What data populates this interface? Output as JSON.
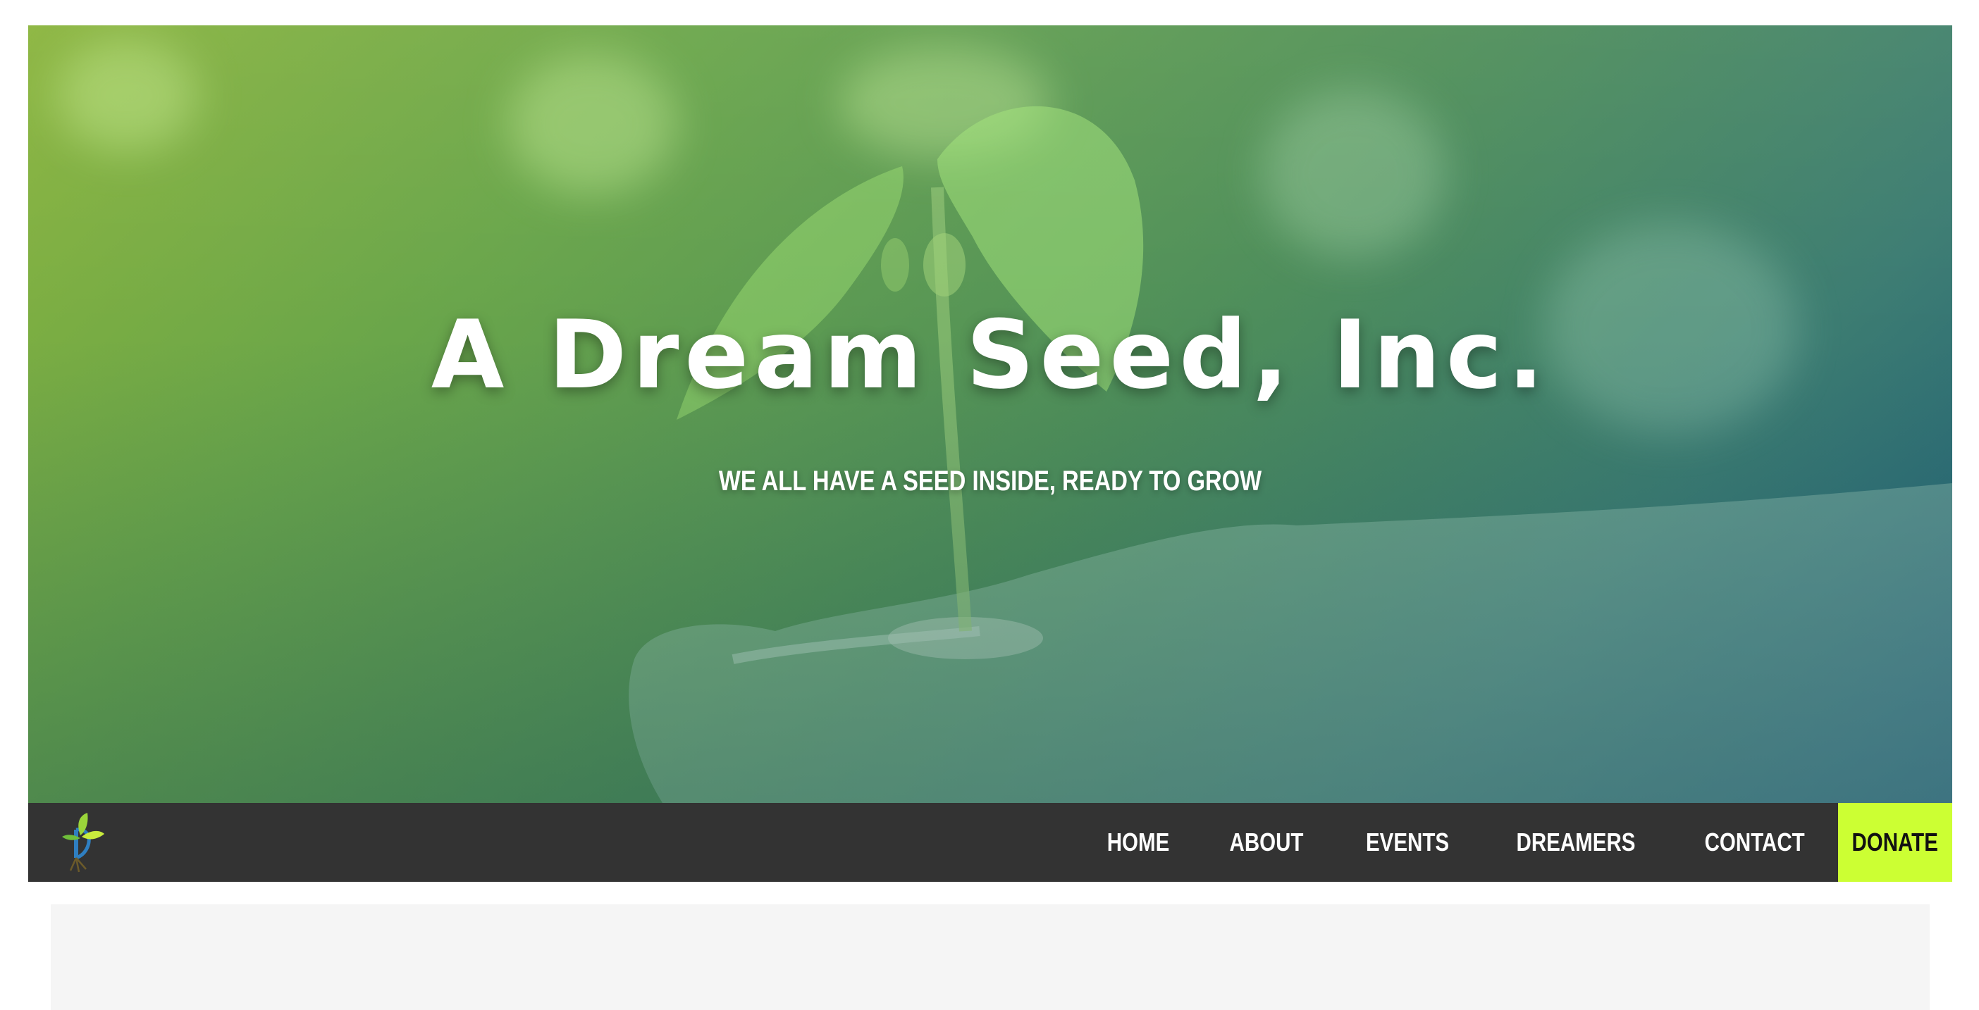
{
  "hero": {
    "title": "A Dream Seed, Inc.",
    "subtitle": "WE ALL HAVE A SEED INSIDE, READY TO GROW"
  },
  "nav": {
    "logo_icon": "dream-seed-sprout-logo",
    "items": [
      {
        "label": "HOME"
      },
      {
        "label": "ABOUT"
      },
      {
        "label": "EVENTS"
      },
      {
        "label": "DREAMERS"
      },
      {
        "label": "CONTACT"
      }
    ],
    "donate_label": "DONATE"
  },
  "colors": {
    "nav_background": "#333333",
    "donate_accent": "#ccff33",
    "hero_gradient_start": "#8ab43c",
    "hero_gradient_end": "#1f5f7a",
    "content_panel": "#f5f5f5"
  }
}
